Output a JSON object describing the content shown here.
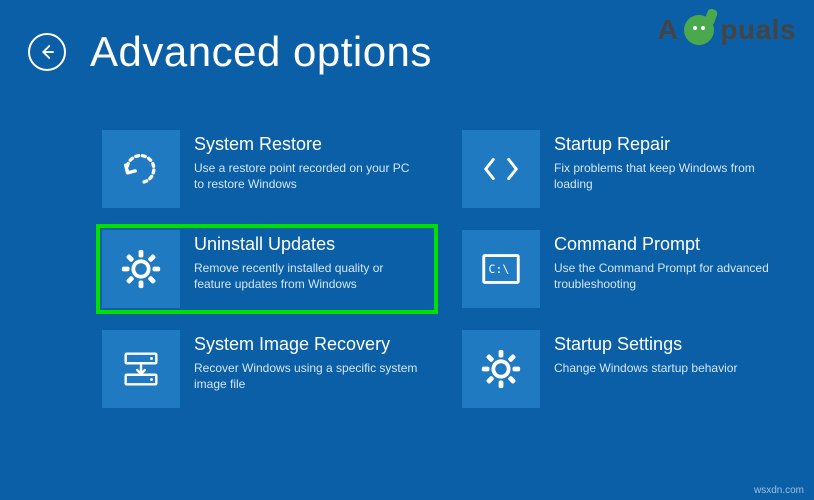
{
  "header": {
    "title": "Advanced options"
  },
  "watermark": {
    "brand_prefix": "A",
    "brand_suffix": "puals"
  },
  "corner_text": "wsxdn.com",
  "options": {
    "system_restore": {
      "title": "System Restore",
      "desc": "Use a restore point recorded on your PC to restore Windows"
    },
    "uninstall_updates": {
      "title": "Uninstall Updates",
      "desc": "Remove recently installed quality or feature updates from Windows"
    },
    "system_image_recovery": {
      "title": "System Image Recovery",
      "desc": "Recover Windows using a specific system image file"
    },
    "startup_repair": {
      "title": "Startup Repair",
      "desc": "Fix problems that keep Windows from loading"
    },
    "command_prompt": {
      "title": "Command Prompt",
      "desc": "Use the Command Prompt for advanced troubleshooting"
    },
    "startup_settings": {
      "title": "Startup Settings",
      "desc": "Change Windows startup behavior"
    }
  }
}
